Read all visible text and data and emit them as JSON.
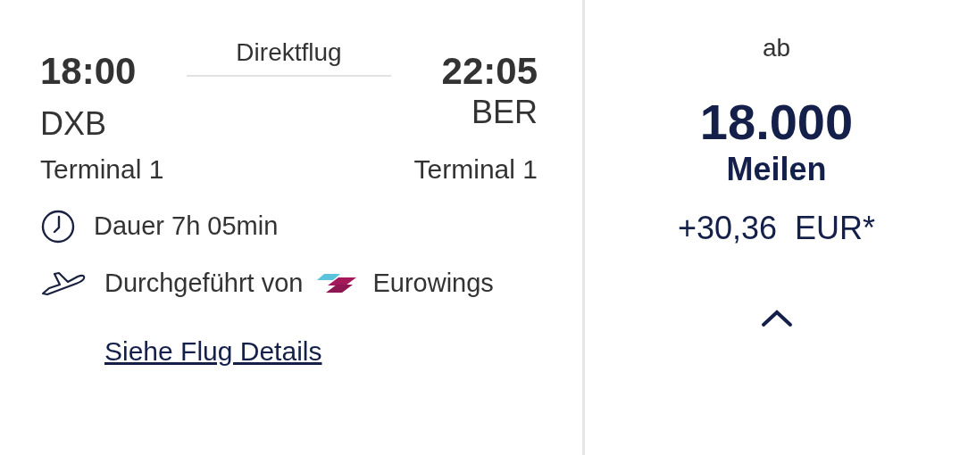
{
  "flight": {
    "departure": {
      "time": "18:00",
      "airport": "DXB",
      "terminal": "Terminal 1"
    },
    "arrival": {
      "time": "22:05",
      "airport": "BER",
      "terminal": "Terminal 1"
    },
    "stops": "Direktflug",
    "duration": "Dauer 7h 05min",
    "operated_by": "Durchgeführt von",
    "airline": "Eurowings",
    "details_link": "Siehe Flug Details"
  },
  "price": {
    "prefix": "ab",
    "miles": "18.000",
    "unit": "Meilen",
    "surcharge": "+30,36  EUR*",
    "expanded": true
  }
}
